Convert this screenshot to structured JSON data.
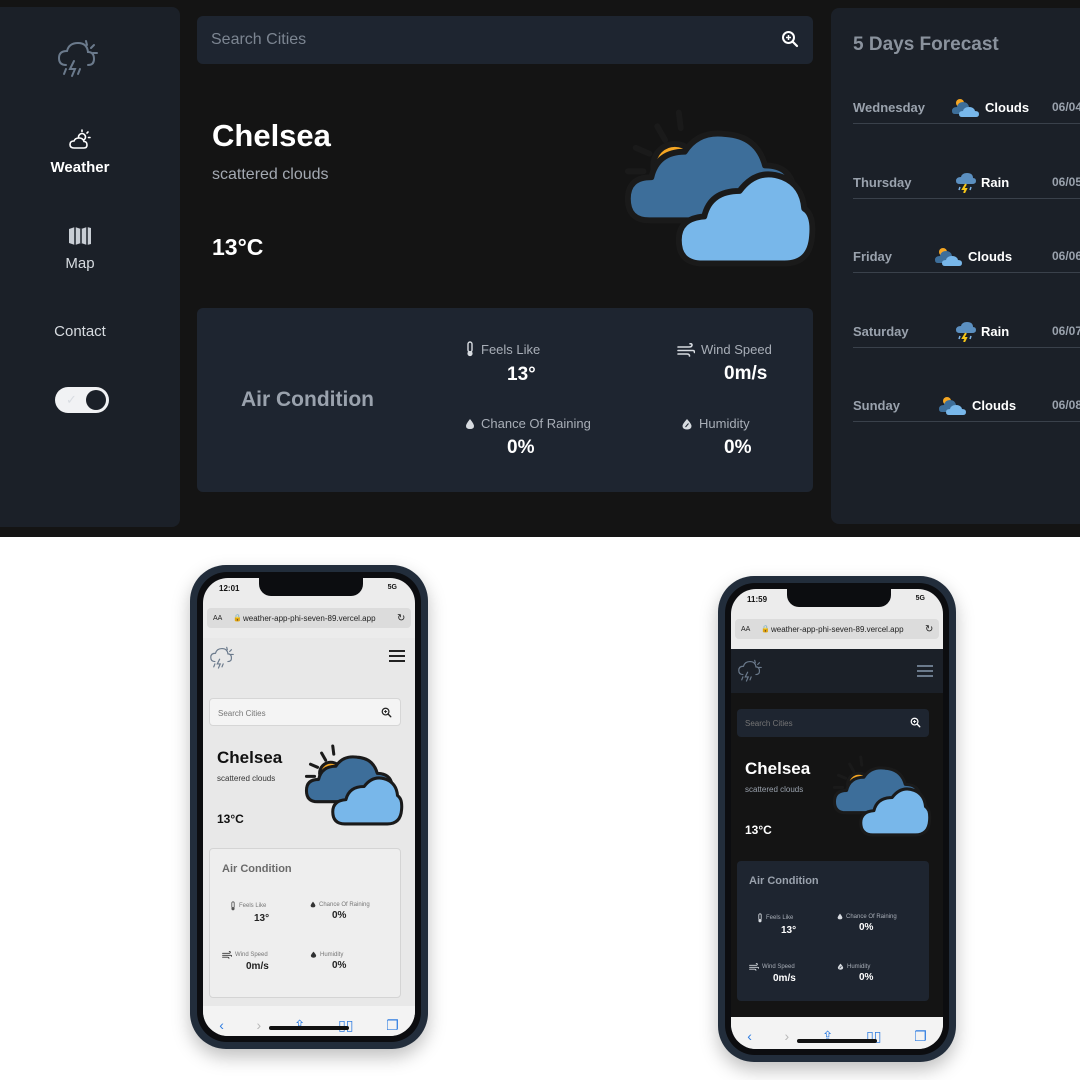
{
  "desktop": {
    "sidebar": {
      "items": [
        {
          "label": "Weather",
          "icon": "cloud-sun-icon"
        },
        {
          "label": "Map",
          "icon": "map-icon"
        },
        {
          "label": "Contact"
        }
      ],
      "theme_toggle": "dark"
    },
    "search": {
      "placeholder": "Search Cities"
    },
    "current": {
      "city": "Chelsea",
      "description": "scattered clouds",
      "temperature": "13°C"
    },
    "air": {
      "title": "Air Condition",
      "feels_like": {
        "label": "Feels Like",
        "value": "13°"
      },
      "wind_speed": {
        "label": "Wind Speed",
        "value": "0m/s"
      },
      "chance_of_raining": {
        "label": "Chance Of Raining",
        "value": "0%"
      },
      "humidity": {
        "label": "Humidity",
        "value": "0%"
      }
    },
    "forecast": {
      "title": "5 Days Forecast",
      "days": [
        {
          "day": "Wednesday",
          "condition": "Clouds",
          "date": "06/04"
        },
        {
          "day": "Thursday",
          "condition": "Rain",
          "date": "06/05"
        },
        {
          "day": "Friday",
          "condition": "Clouds",
          "date": "06/06"
        },
        {
          "day": "Saturday",
          "condition": "Rain",
          "date": "06/07"
        },
        {
          "day": "Sunday",
          "condition": "Clouds",
          "date": "06/08"
        }
      ]
    }
  },
  "phone_light": {
    "time": "12:01",
    "network": "5G",
    "url": "weather-app-phi-seven-89.vercel.app",
    "aa": "AA",
    "search_placeholder": "Search Cities",
    "city": "Chelsea",
    "description": "scattered clouds",
    "temperature": "13°C",
    "air_title": "Air Condition",
    "feels_like_label": "Feels Like",
    "feels_like": "13°",
    "chance_label": "Chance Of Raining",
    "chance": "0%",
    "wind_label": "Wind Speed",
    "wind": "0m/s",
    "humidity_label": "Humidity",
    "humidity": "0%"
  },
  "phone_dark": {
    "time": "11:59",
    "network": "5G",
    "url": "weather-app-phi-seven-89.vercel.app",
    "aa": "AA",
    "search_placeholder": "Search Cities",
    "city": "Chelsea",
    "description": "scattered clouds",
    "temperature": "13°C",
    "air_title": "Air Condition",
    "feels_like_label": "Feels Like",
    "feels_like": "13°",
    "chance_label": "Chance Of Raining",
    "chance": "0%",
    "wind_label": "Wind Speed",
    "wind": "0m/s",
    "humidity_label": "Humidity",
    "humidity": "0%"
  },
  "colors": {
    "desktop_bg": "#141414",
    "panel": "#1e2530",
    "sidebar": "#1b2028",
    "cloud_dark": "#3d6e9a",
    "cloud_light": "#78b7ea",
    "sun": "#f5a623"
  }
}
